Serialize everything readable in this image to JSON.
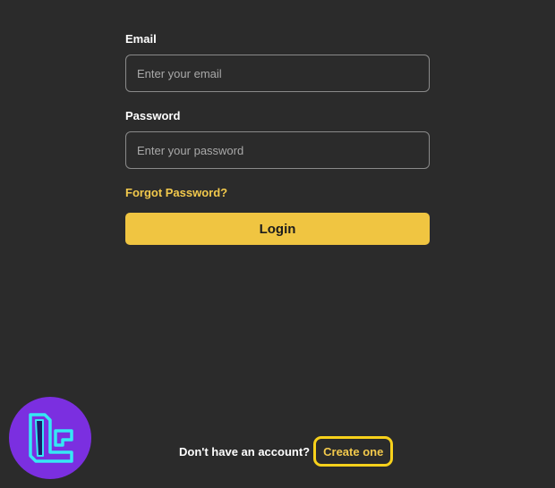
{
  "form": {
    "email_label": "Email",
    "email_placeholder": "Enter your email",
    "password_label": "Password",
    "password_placeholder": "Enter your password",
    "forgot_password": "Forgot Password?",
    "login_label": "Login"
  },
  "signup": {
    "prompt": "Don't have an account?",
    "create_link": "Create one"
  },
  "logo": {
    "icon": "brand-logo-icon"
  },
  "colors": {
    "background": "#2b2b2b",
    "accent": "#f0c541",
    "link": "#f2c94c",
    "highlight_outline": "#f7d11b",
    "logo_circle": "#7b2fe0",
    "logo_stroke": "#35e8f4"
  }
}
